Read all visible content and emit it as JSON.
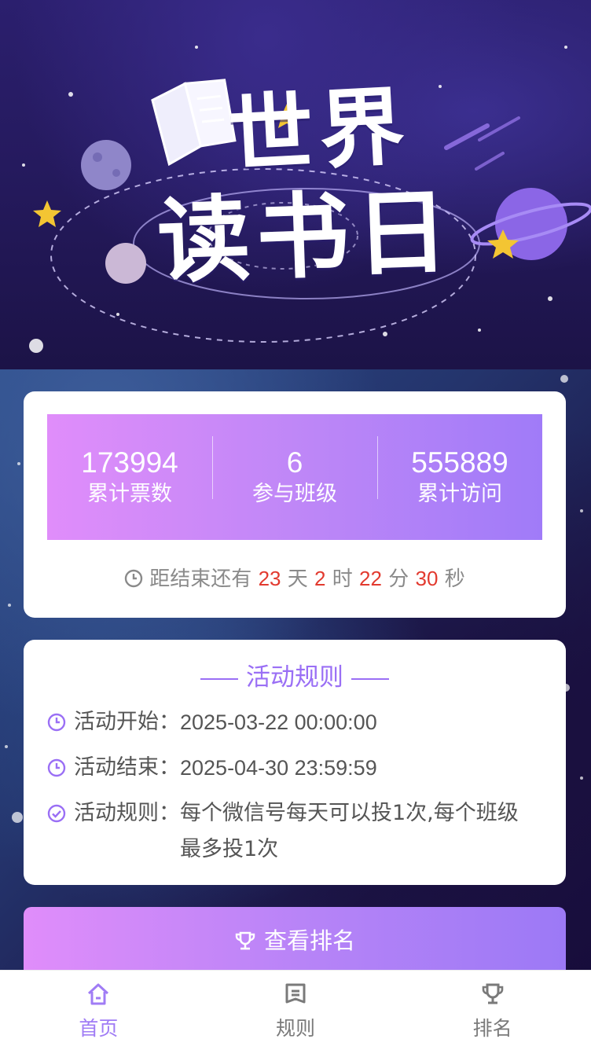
{
  "banner": {
    "title_line1": "世界",
    "title_line2": "读书日"
  },
  "stats": [
    {
      "value": "173994",
      "label": "累计票数"
    },
    {
      "value": "6",
      "label": "参与班级"
    },
    {
      "value": "555889",
      "label": "累计访问"
    }
  ],
  "countdown": {
    "prefix": "距结束还有",
    "days": "23",
    "days_unit": "天",
    "hours": "2",
    "hours_unit": "时",
    "minutes": "22",
    "minutes_unit": "分",
    "seconds": "30",
    "seconds_unit": "秒"
  },
  "rules": {
    "title": "活动规则",
    "items": [
      {
        "label": "活动开始：",
        "value": "2025-03-22 00:00:00",
        "icon": "clock-icon"
      },
      {
        "label": "活动结束：",
        "value": "2025-04-30 23:59:59",
        "icon": "clock-icon"
      },
      {
        "label": "活动规则：",
        "value": "每个微信号每天可以投1次,每个班级最多投1次",
        "icon": "check-circle-icon"
      }
    ]
  },
  "rank_button": {
    "label": "查看排名",
    "icon": "trophy-icon"
  },
  "tabbar": [
    {
      "label": "首页",
      "icon": "home-icon",
      "active": true
    },
    {
      "label": "规则",
      "icon": "bookmark-icon",
      "active": false
    },
    {
      "label": "排名",
      "icon": "trophy-icon",
      "active": false
    }
  ],
  "colors": {
    "accent": "#a07cf5",
    "gradient_start": "#e08dfa",
    "gradient_end": "#9c79f6",
    "countdown_number": "#e23a2f"
  }
}
